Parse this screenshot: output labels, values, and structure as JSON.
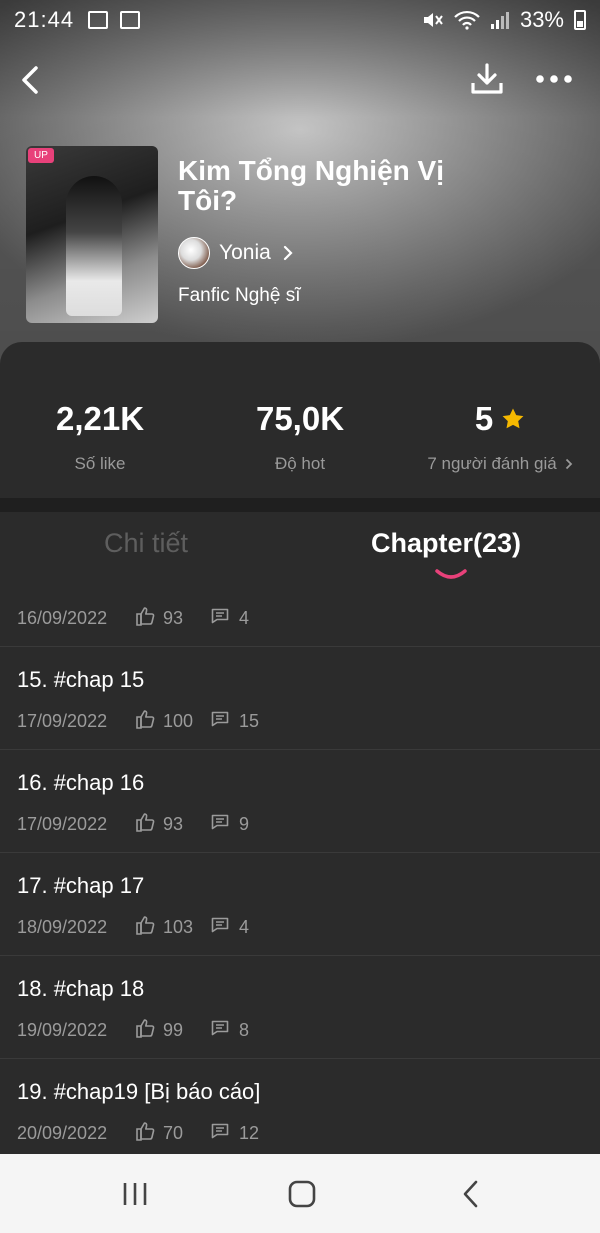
{
  "status_bar": {
    "time": "21:44",
    "battery": "33%"
  },
  "book": {
    "cover_badge": "UP",
    "title": "Kim Tổng Nghiện Vị Tôi?",
    "author": "Yonia",
    "genre": "Fanfic Nghệ sĩ"
  },
  "stats": {
    "likes": {
      "value": "2,21K",
      "label": "Số like"
    },
    "hot": {
      "value": "75,0K",
      "label": "Độ hot"
    },
    "rating": {
      "value": "5",
      "label": "7 người đánh giá"
    }
  },
  "tabs": {
    "detail": "Chi tiết",
    "chapter": "Chapter(23)"
  },
  "chapters": [
    {
      "title": "",
      "date": "16/09/2022",
      "likes": "93",
      "comments": "4"
    },
    {
      "title": "15. #chap 15",
      "date": "17/09/2022",
      "likes": "100",
      "comments": "15"
    },
    {
      "title": "16. #chap 16",
      "date": "17/09/2022",
      "likes": "93",
      "comments": "9"
    },
    {
      "title": "17. #chap 17",
      "date": "18/09/2022",
      "likes": "103",
      "comments": "4"
    },
    {
      "title": "18. #chap 18",
      "date": "19/09/2022",
      "likes": "99",
      "comments": "8"
    },
    {
      "title": "19. #chap19 [Bị báo cáo]",
      "date": "20/09/2022",
      "likes": "70",
      "comments": "12"
    }
  ],
  "colors": {
    "accent": "#e8417a",
    "star": "#f5b800",
    "background": "#2b2b2b"
  }
}
